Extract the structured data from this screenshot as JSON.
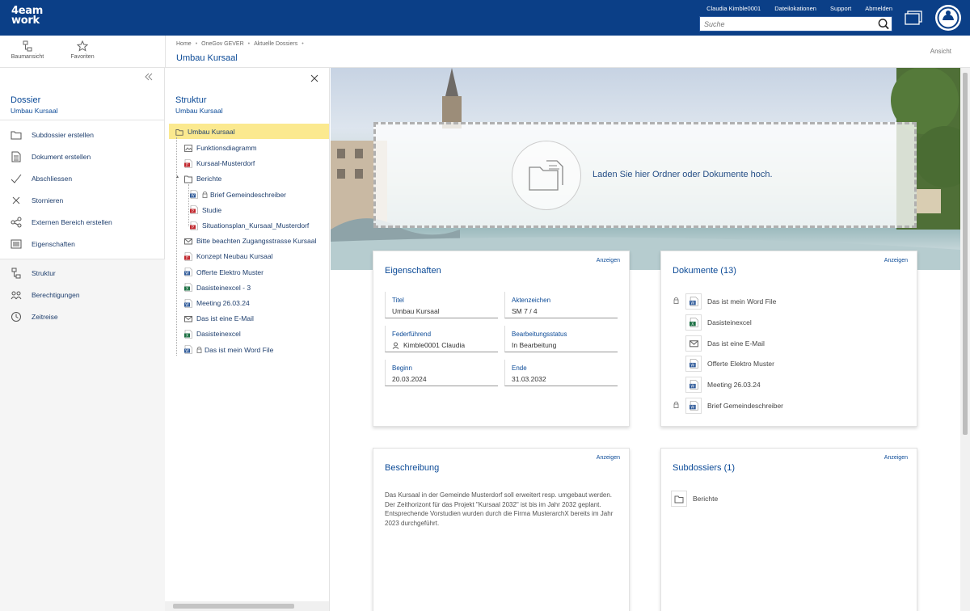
{
  "app": {
    "logo_line1": "4eam",
    "logo_line2": "work"
  },
  "topbar": {
    "user": "Claudia Kimble0001",
    "links": [
      "Dateilokationen",
      "Support",
      "Abmelden"
    ],
    "search_placeholder": "Suche"
  },
  "toolbar": {
    "tree_view_label": "Baumansicht",
    "favorites_label": "Favoriten"
  },
  "breadcrumb": {
    "items": [
      "Home",
      "OneGov GEVER",
      "Aktuelle Dossiers"
    ]
  },
  "page": {
    "title": "Umbau Kursaal",
    "view_label": "Ansicht"
  },
  "sidebar": {
    "title": "Dossier",
    "subtitle": "Umbau Kursaal",
    "actions": [
      {
        "label": "Subdossier erstellen",
        "icon": "folder-icon"
      },
      {
        "label": "Dokument erstellen",
        "icon": "document-icon"
      },
      {
        "label": "Abschliessen",
        "icon": "checkmark-icon"
      },
      {
        "label": "Stornieren",
        "icon": "x-icon"
      },
      {
        "label": "Externen Bereich erstellen",
        "icon": "share-icon"
      },
      {
        "label": "Eigenschaften",
        "icon": "properties-icon"
      }
    ],
    "nav": [
      {
        "label": "Struktur",
        "icon": "structure-icon"
      },
      {
        "label": "Berechtigungen",
        "icon": "users-icon"
      },
      {
        "label": "Zeitreise",
        "icon": "clock-icon"
      }
    ]
  },
  "tree": {
    "title": "Struktur",
    "subtitle": "Umbau Kursaal",
    "root": "Umbau Kursaal",
    "items": [
      {
        "label": "Funktionsdiagramm",
        "icon": "image-file-icon",
        "level": 1
      },
      {
        "label": "Kursaal-Musterdorf",
        "icon": "pdf-file-icon",
        "level": 1
      },
      {
        "label": "Berichte",
        "icon": "folder-icon",
        "level": 1,
        "expander": "▴"
      },
      {
        "label": "Brief Gemeindeschreiber",
        "icon": "word-file-icon",
        "level": 2,
        "locked": true
      },
      {
        "label": "Studie",
        "icon": "pdf-file-icon",
        "level": 2
      },
      {
        "label": "Situationsplan_Kursaal_Musterdorf",
        "icon": "pdf-file-icon",
        "level": 2
      },
      {
        "label": "Bitte beachten Zugangsstrasse Kursaal",
        "icon": "mail-icon",
        "level": 1
      },
      {
        "label": "Konzept Neubau Kursaal",
        "icon": "pdf-file-icon",
        "level": 1
      },
      {
        "label": "Offerte Elektro Muster",
        "icon": "word-file-icon",
        "level": 1
      },
      {
        "label": "Dasisteinexcel - 3",
        "icon": "excel-file-icon",
        "level": 1
      },
      {
        "label": "Meeting 26.03.24",
        "icon": "word-file-icon",
        "level": 1
      },
      {
        "label": "Das ist eine E-Mail",
        "icon": "mail-icon",
        "level": 1
      },
      {
        "label": "Dasisteinexcel",
        "icon": "excel-file-icon",
        "level": 1
      },
      {
        "label": "Das ist mein Word File",
        "icon": "word-file-icon",
        "level": 1,
        "locked": true
      }
    ]
  },
  "upload": {
    "text": "Laden Sie hier Ordner oder Dokumente hoch."
  },
  "properties": {
    "title": "Eigenschaften",
    "link": "Anzeigen",
    "fields": [
      {
        "label": "Titel",
        "value": "Umbau Kursaal"
      },
      {
        "label": "Aktenzeichen",
        "value": "SM 7 / 4"
      },
      {
        "label": "Federführend",
        "value": "Kimble0001 Claudia"
      },
      {
        "label": "Bearbeitungsstatus",
        "value": "In Bearbeitung"
      },
      {
        "label": "Beginn",
        "value": "20.03.2024"
      },
      {
        "label": "Ende",
        "value": "31.03.2032"
      }
    ]
  },
  "documents": {
    "title": "Dokumente (13)",
    "link": "Anzeigen",
    "items": [
      {
        "label": "Das ist mein Word File",
        "icon": "word-file-icon",
        "locked": true
      },
      {
        "label": "Dasisteinexcel",
        "icon": "excel-file-icon",
        "locked": false
      },
      {
        "label": "Das ist eine E-Mail",
        "icon": "mail-icon",
        "locked": false
      },
      {
        "label": "Offerte Elektro Muster",
        "icon": "word-file-icon",
        "locked": false
      },
      {
        "label": "Meeting 26.03.24",
        "icon": "word-file-icon",
        "locked": false
      },
      {
        "label": "Brief Gemeindeschreiber",
        "icon": "word-file-icon",
        "locked": true
      }
    ]
  },
  "description": {
    "title": "Beschreibung",
    "link": "Anzeigen",
    "text": "Das Kursaal in der Gemeinde Musterdorf soll erweitert resp. umgebaut werden. Der Zeithorizont für das Projekt \"Kursaal 2032\" ist bis im Jahr 2032 geplant. Entsprechende Vorstudien wurden durch die Firma MusterarchX bereits im Jahr 2023 durchgeführt."
  },
  "subdossiers": {
    "title": "Subdossiers (1)",
    "link": "Anzeigen",
    "items": [
      {
        "label": "Berichte",
        "icon": "folder-icon"
      }
    ]
  }
}
